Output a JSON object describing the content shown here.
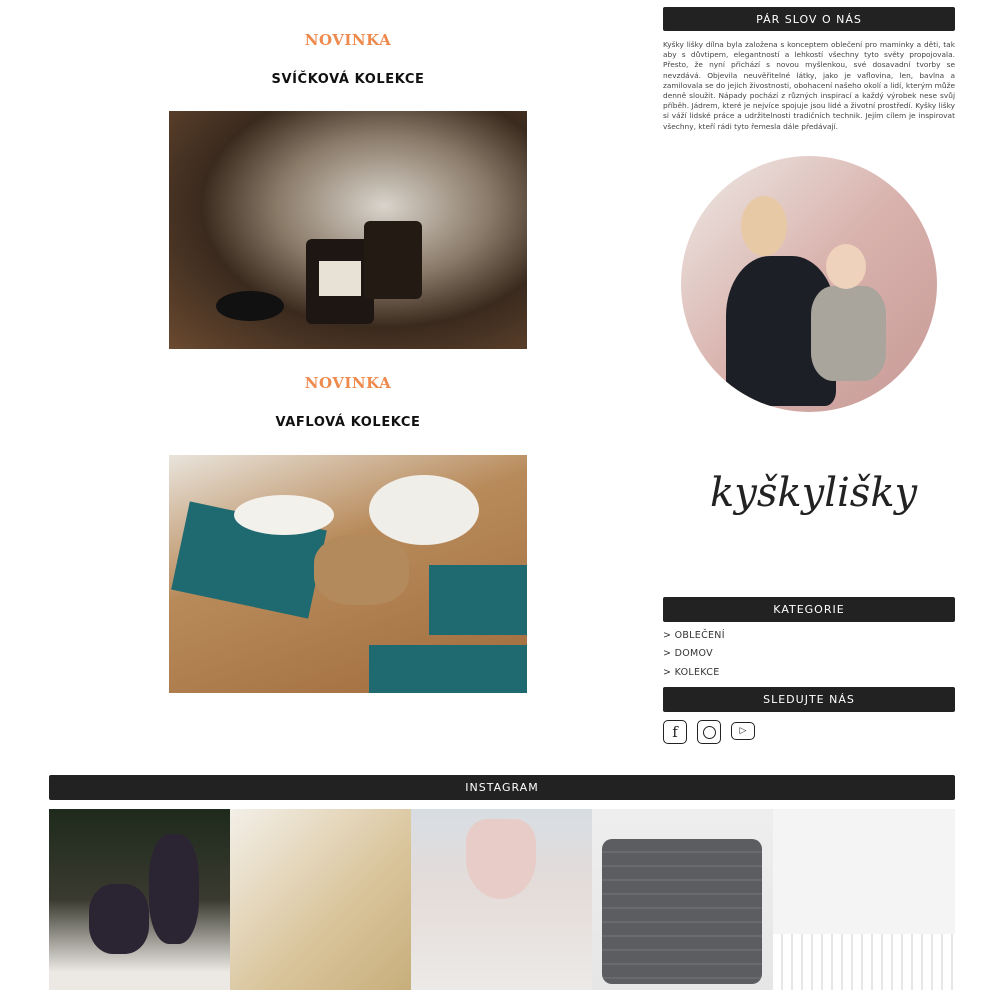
{
  "posts": [
    {
      "badge": "NOVINKA",
      "title": "SVÍČKOVÁ KOLEKCE"
    },
    {
      "badge": "NOVINKA",
      "title": "VAFLOVÁ KOLEKCE"
    }
  ],
  "sidebar": {
    "about_title": "PÁR SLOV O NÁS",
    "about_text": "Kyšky lišky dílna byla založena s konceptem oblečení pro maminky a děti, tak aby s důvtipem, elegantností a lehkostí všechny tyto světy propojovala. Přesto, že nyní přichází s novou myšlenkou, své dosavadní tvorby se nevzdává. Objevila neuvěřitelné látky, jako je vaflovina, len, bavlna a zamilovala se do jejich živostnosti, obohacení našeho okolí a lidí, kterým může denně sloužit. Nápady pochází z různých inspirací a každý výrobek nese svůj příběh. Jádrem, které je nejvíce spojuje jsou lidé a životní prostředí. Kyšky lišky si váží lidské práce a udržitelnosti tradičních technik. Jejím cílem je inspirovat všechny, kteří rádi tyto řemesla dále předávají.",
    "logo_text": "kyškylišky",
    "categories_title": "KATEGORIE",
    "categories": [
      "> OBLEČENÍ",
      "> DOMOV",
      "> KOLEKCE"
    ],
    "follow_title": "SLEDUJTE NÁS",
    "social": [
      "facebook-icon",
      "instagram-icon",
      "youtube-icon"
    ]
  },
  "instagram": {
    "title": "INSTAGRAM"
  },
  "colors": {
    "accent": "#ee8a4e",
    "bar": "#222222"
  }
}
